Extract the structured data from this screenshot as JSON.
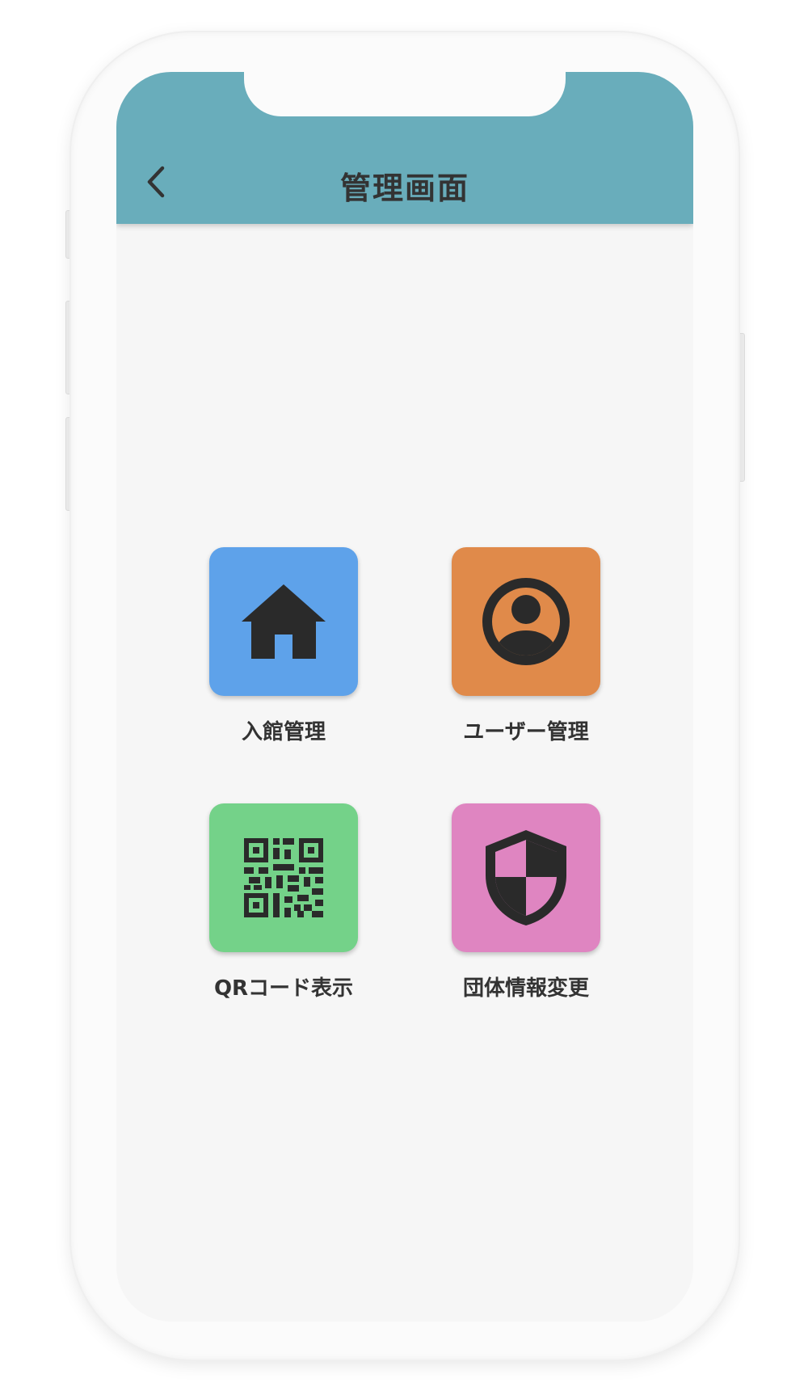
{
  "header": {
    "title": "管理画面",
    "back_icon": "chevron-left-icon",
    "color": "#69adbb"
  },
  "menu": [
    {
      "label": "入館管理",
      "icon": "home-icon",
      "color": "#5ea2ea"
    },
    {
      "label": "ユーザー管理",
      "icon": "account-circle-icon",
      "color": "#e08a4a"
    },
    {
      "label": "QRコード表示",
      "icon": "qr-code-icon",
      "color": "#74d289"
    },
    {
      "label": "団体情報変更",
      "icon": "shield-icon",
      "color": "#df85c1"
    }
  ]
}
